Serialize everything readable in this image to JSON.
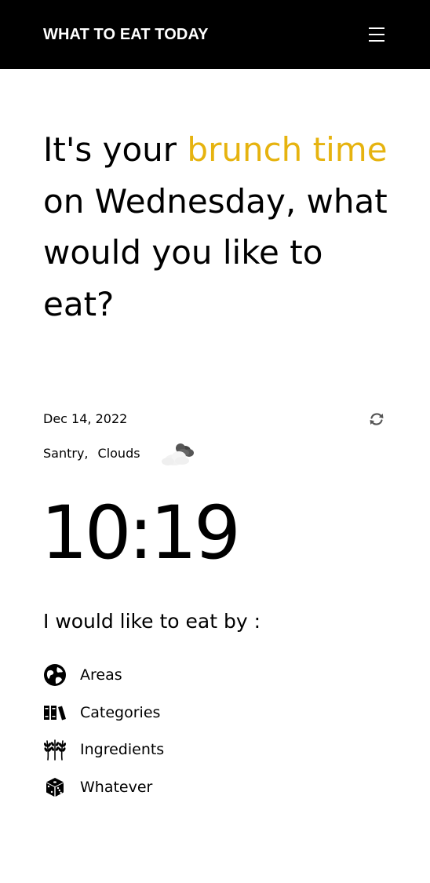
{
  "header": {
    "title": "WHAT TO EAT TODAY",
    "menu_icon": "hamburger-menu-icon"
  },
  "headline": {
    "part1": "It's your ",
    "meal": "brunch time",
    "part2": " on Wednesday, what would you like to eat?",
    "accent_color": "#e6b30f"
  },
  "info": {
    "date": "Dec 14, 2022",
    "refresh_icon": "refresh-icon",
    "city": "Santry,",
    "weather": "Clouds",
    "weather_icon": "clouds-icon"
  },
  "clock": {
    "time": "10:19"
  },
  "prompt": "I would like to eat by :",
  "options": [
    {
      "label": "Areas",
      "icon": "globe-icon"
    },
    {
      "label": "Categories",
      "icon": "books-icon"
    },
    {
      "label": "Ingredients",
      "icon": "wheat-icon"
    },
    {
      "label": "Whatever",
      "icon": "dice-icon"
    }
  ]
}
